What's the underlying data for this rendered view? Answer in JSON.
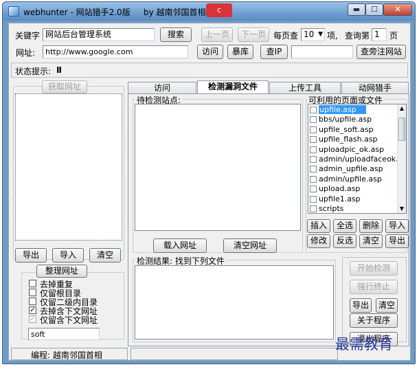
{
  "window": {
    "title": "webhunter  - 网站猎手2.0版",
    "author_tag": "by 越南邻国首相",
    "red_tag": "c"
  },
  "toolbar": {
    "keyword_label": "关键字",
    "keyword_value": "网站后台管理系统",
    "search_label": "搜索",
    "prev_label": "上一页",
    "next_label": "下一页",
    "per_page_label": "每页查",
    "per_page_value": "10",
    "items_label": "项,",
    "query_page_label": "查询第",
    "query_page_value": "1",
    "page_label": "页",
    "url_label": "网址:",
    "url_value": "http://www.google.com",
    "visit_label": "访问",
    "storage_label": "暴库",
    "check_ip_label": "查IP",
    "ip_value": "",
    "side_site_label": "查旁注网站"
  },
  "status": {
    "label": "状态提示:",
    "value": "Ⅱ"
  },
  "left_panel": {
    "get_url_label": "获取网址",
    "export_label": "导出",
    "import_label": "导入",
    "clear_label": "清空"
  },
  "organize": {
    "title": "整理网址",
    "options": [
      {
        "label": "去掉重复",
        "checked": false,
        "disabled": false
      },
      {
        "label": "仅留根目录",
        "checked": false,
        "disabled": false
      },
      {
        "label": "仅留二级内目录",
        "checked": false,
        "disabled": false
      },
      {
        "label": "去掉含下文网址",
        "checked": true,
        "disabled": false
      },
      {
        "label": "仅留含下文网址",
        "checked": true,
        "disabled": true
      }
    ],
    "filter_value": "soft"
  },
  "footer": {
    "credit": "编程: 越南邻国首相"
  },
  "tabs": [
    {
      "label": "访问"
    },
    {
      "label": "检测漏洞文件"
    },
    {
      "label": "上传工具"
    },
    {
      "label": "动网猎手"
    }
  ],
  "detect": {
    "pending_label": "待检测站点:",
    "load_url_label": "载入网址",
    "clear_url_label": "清空网址",
    "pages_label": "可利用的页面或文件",
    "files": [
      "upfile.asp",
      "bbs/upfile.asp",
      "upfile_soft.asp",
      "upfile_flash.asp",
      "uploadpic_ok.asp",
      "admin/uploadfaceok.asp",
      "admin_upfile.asp",
      "admin/upfile.asp",
      "upload.asp",
      "upfile1.asp",
      "scripts"
    ],
    "selected_index": 0,
    "file_buttons": [
      "插入",
      "全选",
      "删除",
      "导入",
      "修改",
      "反选",
      "清空",
      "导出"
    ],
    "result_label": "检测结果: 找到下列文件",
    "start_label": "开始检测",
    "stop_label": "强行终止",
    "export_label": "导出",
    "clear_label": "清空",
    "about_label": "关于程序",
    "exit_label": "退出程序"
  },
  "watermark": "最需教育",
  "colors": {
    "selected": "#3399ff",
    "titlebar": "#6f9fd0"
  }
}
